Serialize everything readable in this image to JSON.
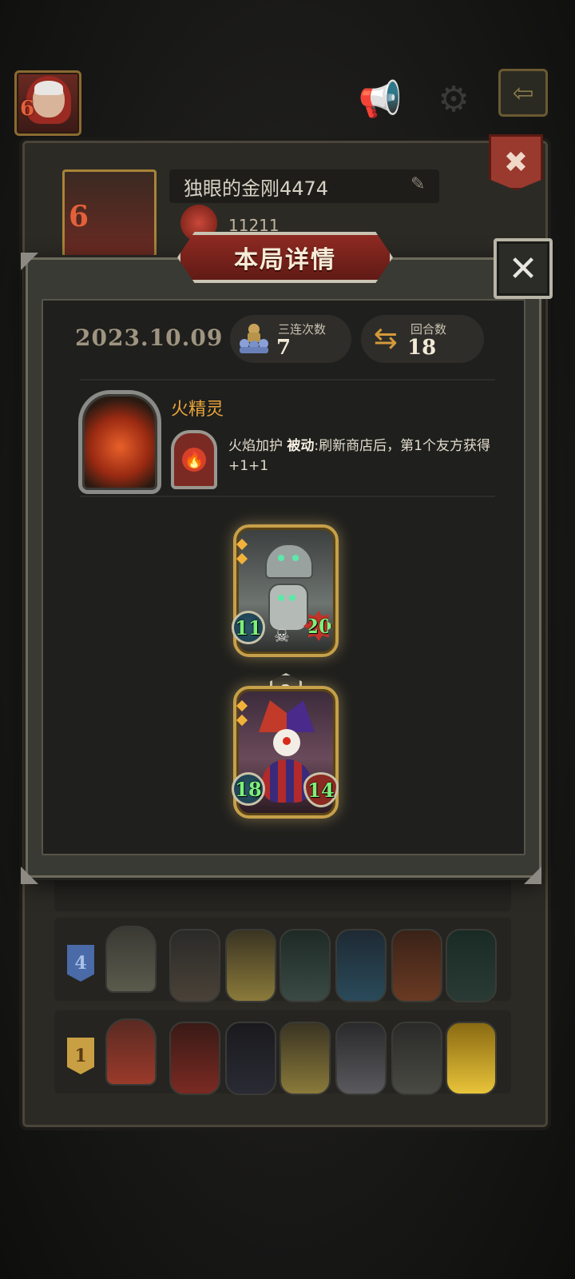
{
  "background": {
    "player_name": "独眼的金刚4474",
    "player_score": "11211",
    "player_level": "6",
    "rows": [
      {
        "rank": "4",
        "rank_color": "#4a6aa8"
      },
      {
        "rank": "1",
        "rank_color": "#c8a043"
      }
    ]
  },
  "modal": {
    "title": "本局详情",
    "date": "2023.10.09",
    "triples": {
      "label": "三连次数",
      "value": "7"
    },
    "rounds": {
      "label": "回合数",
      "value": "18"
    },
    "hero": {
      "name": "火精灵",
      "power_name": "火焰加护",
      "power_type": "被动",
      "power_desc": ":刷新商店后，第1个友方获得+1+1"
    },
    "minions": [
      {
        "name": "robot",
        "attack": "11",
        "health": "20"
      },
      {
        "name": "clown",
        "tier": "2",
        "attack": "18",
        "health": "14"
      }
    ]
  },
  "colors": {
    "accent_gold": "#e8a43a",
    "title_red": "#8e2a22",
    "stat_green": "#7cf07a"
  },
  "icons": {
    "sound": "megaphone-icon",
    "settings": "gear-icon",
    "exit": "exit-arrow-icon",
    "close": "close-x-icon",
    "edit": "pencil-icon"
  }
}
